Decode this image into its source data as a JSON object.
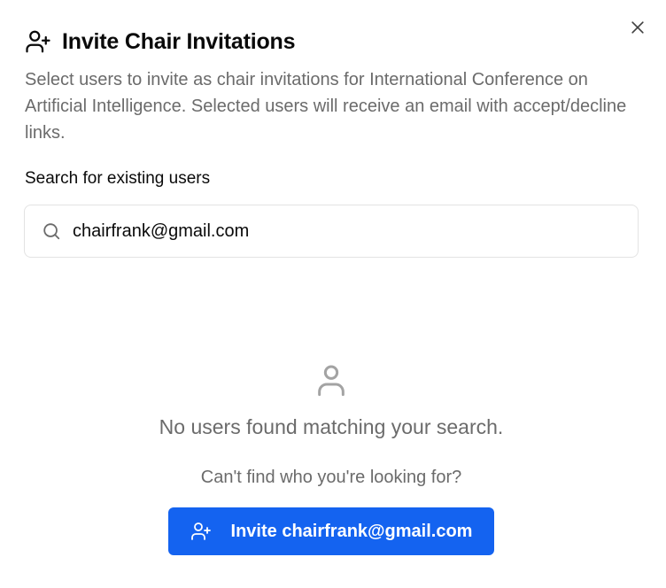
{
  "dialog": {
    "title": "Invite Chair Invitations",
    "title_icon": "user-plus-icon",
    "description": "Select users to invite as chair invitations for International Conference on Artificial Intelligence. Selected users will receive an email with accept/decline links.",
    "close_icon": "close-icon"
  },
  "search": {
    "label": "Search for existing users",
    "value": "chairfrank@gmail.com",
    "placeholder": "",
    "icon": "search-icon"
  },
  "empty_state": {
    "icon": "user-icon",
    "message": "No users found matching your search.",
    "help_text": "Can't find who you're looking for?"
  },
  "invite_button": {
    "label": "Invite chairfrank@gmail.com",
    "icon": "user-plus-icon",
    "color": "#1463f0"
  }
}
